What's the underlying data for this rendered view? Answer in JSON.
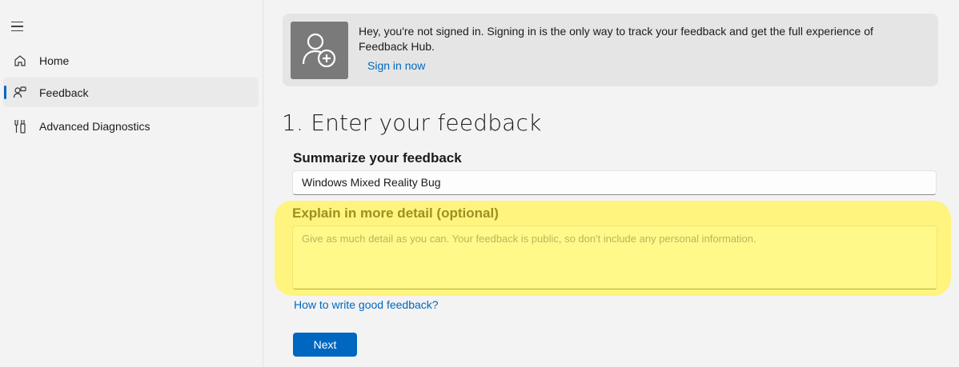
{
  "sidebar": {
    "menu_icon": "hamburger-menu-icon",
    "items": [
      {
        "label": "Home",
        "icon": "home-icon",
        "active": false
      },
      {
        "label": "Feedback",
        "icon": "feedback-icon",
        "active": true
      },
      {
        "label": "Advanced Diagnostics",
        "icon": "diagnostics-icon",
        "active": false
      }
    ]
  },
  "banner": {
    "icon": "person-add-icon",
    "message": "Hey, you're not signed in. Signing in is the only way to track your feedback and get the full experience of Feedback Hub.",
    "signin_label": "Sign in now"
  },
  "main": {
    "title": "1. Enter your feedback",
    "summary_label": "Summarize your feedback",
    "summary_value": "Windows Mixed Reality Bug",
    "detail_label": "Explain in more detail (optional)",
    "detail_placeholder": "Give as much detail as you can. Your feedback is public, so don't include any personal information.",
    "howto_link": "How to write good feedback?",
    "next_label": "Next"
  },
  "colors": {
    "accent": "#0067c0",
    "highlight": "#fff47d",
    "background": "#f3f3f3"
  }
}
